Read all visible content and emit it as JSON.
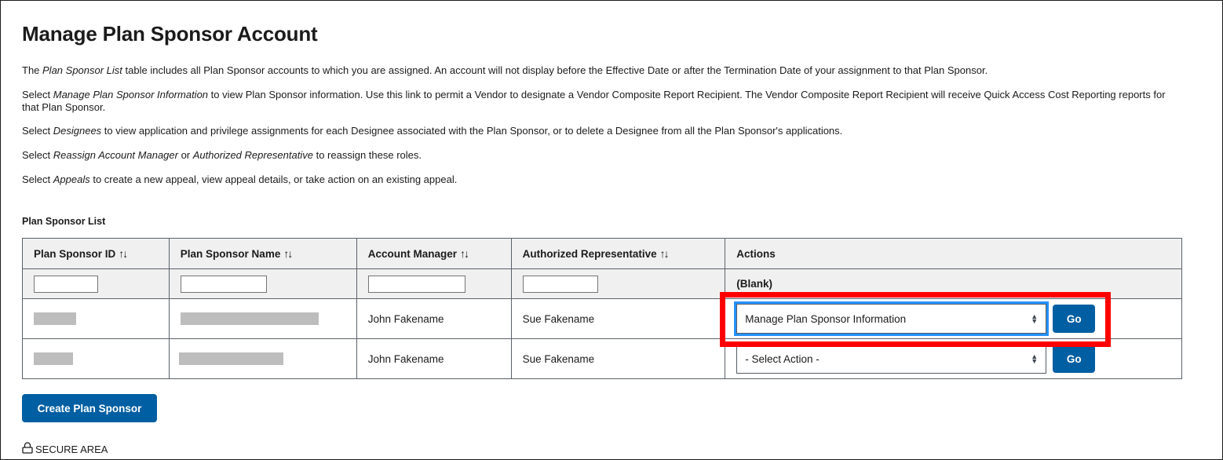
{
  "page": {
    "title": "Manage Plan Sponsor Account"
  },
  "intro": {
    "p1": {
      "a": "The ",
      "em": "Plan Sponsor List",
      "b": " table includes all Plan Sponsor accounts to which you are assigned. An account will not display before the Effective Date or after the Termination Date of your assignment to that Plan Sponsor."
    },
    "p2": {
      "a": "Select ",
      "em": "Manage Plan Sponsor Information",
      "b": " to view Plan Sponsor information. Use this link to permit a Vendor to designate a Vendor Composite Report Recipient. The Vendor Composite Report Recipient will receive Quick Access Cost Reporting reports for that Plan Sponsor."
    },
    "p3": {
      "a": "Select ",
      "em": "Designees",
      "b": " to view application and privilege assignments for each Designee associated with the Plan Sponsor, or to delete a Designee from all the Plan Sponsor's applications."
    },
    "p4": {
      "a": "Select ",
      "em1": "Reassign Account Manager",
      "mid": " or ",
      "em2": "Authorized Representative",
      "b": " to reassign these roles."
    },
    "p5": {
      "a": "Select ",
      "em": "Appeals",
      "b": " to create a new appeal, view appeal details, or take action on an existing appeal."
    }
  },
  "table": {
    "label": "Plan Sponsor List",
    "sort_icon": "↑↓",
    "columns": [
      {
        "label": "Plan Sponsor ID",
        "sortable": true
      },
      {
        "label": "Plan Sponsor Name",
        "sortable": true
      },
      {
        "label": "Account Manager",
        "sortable": true
      },
      {
        "label": "Authorized Representative",
        "sortable": true
      },
      {
        "label": "Actions",
        "sortable": false
      }
    ],
    "filters": {
      "id": "",
      "name": "",
      "account_manager": "",
      "authorized_rep": "",
      "actions_label": "(Blank)"
    },
    "rows": [
      {
        "id": "[redacted]",
        "name": "[redacted]",
        "account_manager": "John Fakename",
        "authorized_rep": "Sue Fakename",
        "action_selected": "Manage Plan Sponsor Information",
        "go_label": "Go",
        "highlighted": true
      },
      {
        "id": "[redacted]",
        "name": "[redacted]",
        "account_manager": "John Fakename",
        "authorized_rep": "Sue Fakename",
        "action_selected": "- Select Action -",
        "go_label": "Go",
        "highlighted": false
      }
    ]
  },
  "buttons": {
    "create_plan_sponsor": "Create Plan Sponsor"
  },
  "footer": {
    "secure_icon": "lock-icon",
    "secure_label": "SECURE AREA"
  },
  "colors": {
    "primary_button": "#005ea2",
    "focus_outline": "#2491ff",
    "annotation_highlight": "#ff0000",
    "header_bg": "#f0f0f0",
    "redaction": "#bdbdbd"
  }
}
